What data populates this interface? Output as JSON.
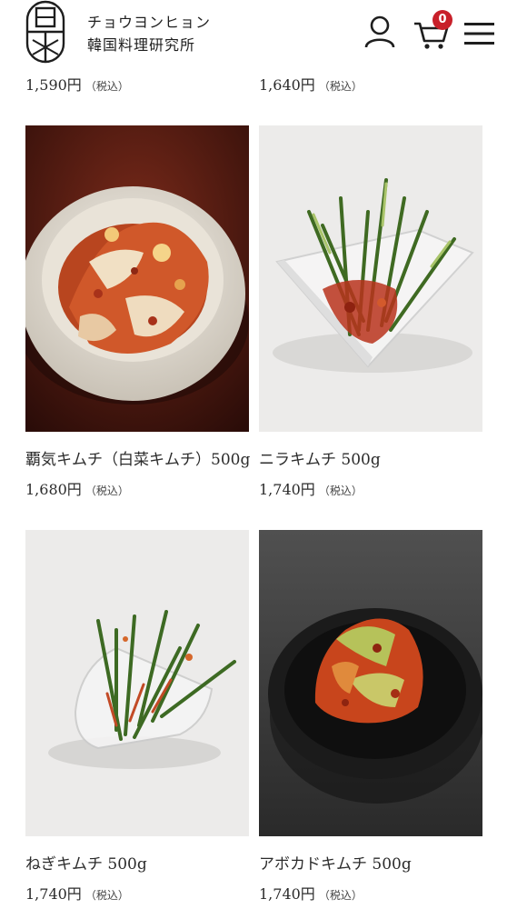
{
  "header": {
    "brand_line1": "チョウヨンヒョン",
    "brand_line2": "韓国料理研究所",
    "cart_count": "0"
  },
  "top_row": [
    {
      "price": "1,590円",
      "tax": "（税込）"
    },
    {
      "price": "1,640円",
      "tax": "（税込）"
    }
  ],
  "products": [
    {
      "name": "覇気キムチ（白菜キムチ）500g",
      "price": "1,680円",
      "tax": "（税込）",
      "image": "napa-cabbage-kimchi"
    },
    {
      "name": "ニラキムチ 500g",
      "price": "1,740円",
      "tax": "（税込）",
      "image": "chive-kimchi"
    },
    {
      "name": "ねぎキムチ 500g",
      "price": "1,740円",
      "tax": "（税込）",
      "image": "green-onion-kimchi"
    },
    {
      "name": "アボカドキムチ 500g",
      "price": "1,740円",
      "tax": "（税込）",
      "image": "avocado-kimchi"
    }
  ],
  "colors": {
    "badge": "#c8202a",
    "text": "#2b2b2b",
    "kimchi_red": "#c23a22"
  }
}
